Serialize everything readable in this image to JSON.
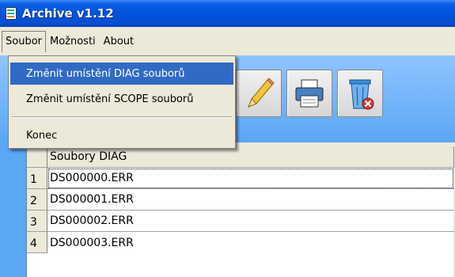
{
  "window": {
    "title": "Archive v1.12"
  },
  "menubar": {
    "items": [
      "Soubor",
      "Možnosti",
      "About"
    ]
  },
  "menu_soubor": {
    "items": [
      "Změnit umístění DIAG souborů",
      "Změnit umístění SCOPE souborů",
      "Konec"
    ],
    "selected": "Změnit umístění DIAG souborů"
  },
  "toolbar": {
    "buttons": [
      "edit-icon",
      "print-icon",
      "recycle-bin-icon"
    ]
  },
  "grid": {
    "header": "Soubory DIAG",
    "rows": [
      {
        "num": "1",
        "file": "DS000000.ERR"
      },
      {
        "num": "2",
        "file": "DS000001.ERR"
      },
      {
        "num": "3",
        "file": "DS000002.ERR"
      },
      {
        "num": "4",
        "file": "DS000003.ERR"
      }
    ]
  },
  "colors": {
    "titlebar": "#0052de",
    "toolbar": "#5aa7f5",
    "menu_highlight": "#316ac5"
  }
}
